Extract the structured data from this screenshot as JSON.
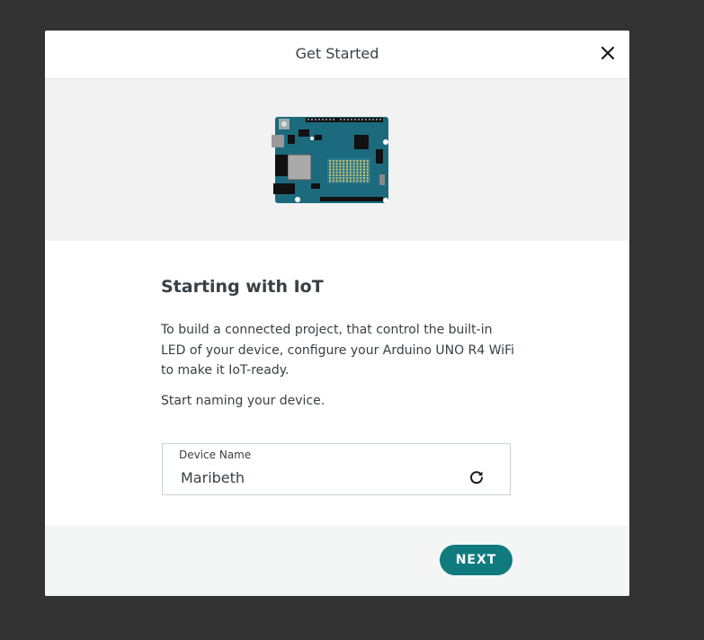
{
  "modal": {
    "title": "Get Started",
    "close_icon": "close-icon"
  },
  "hero": {
    "illustration": "arduino-board-illustration",
    "board_color": "#1c6a7e"
  },
  "content": {
    "heading": "Starting with IoT",
    "description": "To build a connected project, that control the built-in LED of your device, configure your Arduino UNO R4 WiFi to make it IoT-ready.",
    "prompt": "Start naming your device."
  },
  "device_name_field": {
    "label": "Device Name",
    "value": "Maribeth",
    "refresh_icon": "refresh-icon"
  },
  "footer": {
    "next_label": "NEXT"
  },
  "colors": {
    "accent": "#0f7b7f",
    "text": "#374146",
    "backdrop": "#333333"
  }
}
